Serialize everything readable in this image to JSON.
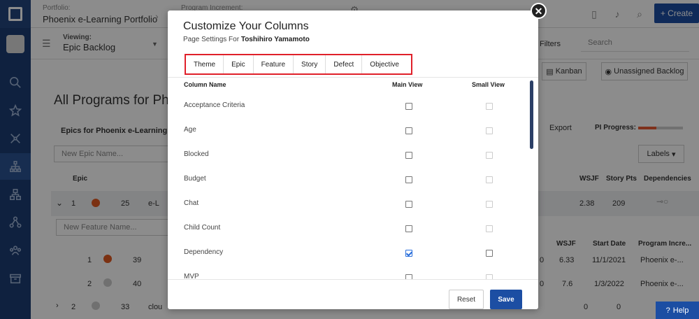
{
  "colors": {
    "nav_bg": "#1c3d73",
    "primary": "#1c4ea3",
    "highlight_border": "#e0202a",
    "progress_fill": "#e85a33",
    "checkbox_check": "#2a6fdb"
  },
  "header": {
    "portfolio_label": "Portfolio:",
    "portfolio_value": "Phoenix e-Learning Portfolio",
    "pi_label": "Program Increment:",
    "create_label": "Create",
    "icons": [
      "clipboard-icon",
      "bell-icon",
      "search-icon",
      "plus-icon"
    ]
  },
  "subbar": {
    "viewing_label": "Viewing:",
    "viewing_value": "Epic Backlog",
    "filters_label": "Filters",
    "search_placeholder": "Search",
    "kanban_label": "Kanban",
    "unassigned_label": "Unassigned Backlog"
  },
  "background": {
    "page_title": "All Programs for Pho",
    "epics_section": "Epics for  Phoenix e-Learning",
    "export_label": "Export",
    "pi_progress_label": "PI Progress:",
    "pi_progress_fraction": 0.4,
    "new_epic_placeholder": "New Epic Name...",
    "labels_button": "Labels",
    "epic_col": "Epic",
    "wsjf_col": "WSJF",
    "story_pts_col": "Story Pts",
    "dependencies_col": "Dependencies",
    "epic_row": {
      "num": "1",
      "count": "25",
      "name": "e-L",
      "wsjf": "2.38",
      "pts": "209"
    },
    "new_feature_placeholder": "New Feature Name...",
    "feature_cols": {
      "wsjf": "WSJF",
      "start": "Start Date",
      "pi": "Program Incre..."
    },
    "feature_rows": [
      {
        "num": "1",
        "count": "39",
        "zero": "0",
        "wsjf": "6.33",
        "start": "11/1/2021",
        "pi": "Phoenix e-..."
      },
      {
        "num": "2",
        "count": "40",
        "zero": "0",
        "wsjf": "7.6",
        "start": "1/3/2022",
        "pi": "Phoenix e-..."
      }
    ],
    "epic_row2": {
      "num": "2",
      "count": "33",
      "name": "clou",
      "a": "0",
      "b": "0"
    }
  },
  "modal": {
    "title": "Customize Your Columns",
    "subtitle_prefix": "Page Settings For",
    "subtitle_user": "Toshihiro Yamamoto",
    "tabs": [
      {
        "label": "Theme"
      },
      {
        "label": "Epic"
      },
      {
        "label": "Feature"
      },
      {
        "label": "Story"
      },
      {
        "label": "Defect"
      },
      {
        "label": "Objective"
      }
    ],
    "col_name_header": "Column Name",
    "main_view_header": "Main View",
    "small_view_header": "Small View",
    "rows": [
      {
        "name": "Acceptance Criteria",
        "main": false,
        "small": false,
        "small_enabled": false
      },
      {
        "name": "Age",
        "main": false,
        "small": false,
        "small_enabled": false
      },
      {
        "name": "Blocked",
        "main": false,
        "small": false,
        "small_enabled": false
      },
      {
        "name": "Budget",
        "main": false,
        "small": false,
        "small_enabled": false
      },
      {
        "name": "Chat",
        "main": false,
        "small": false,
        "small_enabled": false
      },
      {
        "name": "Child Count",
        "main": false,
        "small": false,
        "small_enabled": false
      },
      {
        "name": "Dependency",
        "main": true,
        "small": false,
        "small_enabled": true
      },
      {
        "name": "MVP",
        "main": false,
        "small": false,
        "small_enabled": false
      }
    ],
    "reset_label": "Reset",
    "save_label": "Save",
    "close_symbol": "✕"
  },
  "help_label": "Help"
}
